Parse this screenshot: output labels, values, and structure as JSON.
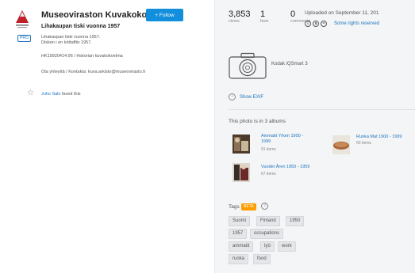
{
  "owner": {
    "name": "Museoviraston Kuvakoko...",
    "follow_label": "+ Follow",
    "pro_badge": "PRO",
    "logo_icon": "museovirasto-logo"
  },
  "photo": {
    "title": "Lihakaupan tiski vuonna 1957",
    "description_lines": [
      "Lihakaupan tiski vuonna 1957.",
      "Disken i en köttaffär 1957.",
      "HK19920414:96 / Historian kuvakokoelma",
      "Ota yhteyttä / Kontakta: kuva.arkisto@museovirasto.fi"
    ]
  },
  "faves_line": {
    "user": "Juho Salo",
    "text": "faved this"
  },
  "stats": [
    {
      "value": "3,853",
      "label": "views"
    },
    {
      "value": "1",
      "label": "fave"
    },
    {
      "value": "0",
      "label": "comments"
    }
  ],
  "upload": {
    "text": "Uploaded on September 11, 201",
    "license_icons": [
      "cc-by-icon",
      "cc-nc-icon",
      "cc-nd-icon"
    ],
    "rights_label": "Some rights reserved"
  },
  "camera": {
    "name": "Kodak iQSmart 3",
    "show_exif": "Show EXIF"
  },
  "albums": {
    "heading": "This photo is in 3 albums",
    "items": [
      {
        "title_line1": "Ammatit Yrken 1900 -",
        "title_line2": "1999",
        "count": "91 items"
      },
      {
        "title_line1": "Ruoka Mat 1900 - 1999",
        "title_line2": "",
        "count": "60 items"
      },
      {
        "title_line1": "Vuodet Åren 1950 - 1959",
        "title_line2": "",
        "count": "67 items"
      }
    ]
  },
  "tags": {
    "label": "Tags",
    "beta": "BETA",
    "help": "?",
    "items": [
      "Suomi",
      "Finland",
      "1950",
      "1957",
      "occupations",
      "ammatit",
      "työ",
      "work",
      "ruoka",
      "food"
    ]
  },
  "colors": {
    "accent": "#128fdc",
    "link": "#1e73be",
    "beta": "#ff9c00",
    "panel": "#f3f5f6"
  }
}
